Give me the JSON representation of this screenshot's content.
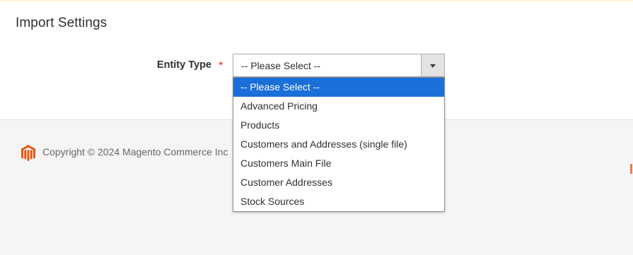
{
  "section": {
    "title": "Import Settings"
  },
  "entity_type": {
    "label": "Entity Type",
    "required_mark": "*",
    "selected_value": "-- Please Select --",
    "options": [
      "-- Please Select --",
      "Advanced Pricing",
      "Products",
      "Customers and Addresses (single file)",
      "Customers Main File",
      "Customer Addresses",
      "Stock Sources"
    ]
  },
  "footer": {
    "copyright": "Copyright © 2024 Magento Commerce Inc"
  },
  "colors": {
    "selected_option_bg": "#1a6fd8",
    "required_star": "#e22626",
    "brand_orange": "#eb5202"
  }
}
